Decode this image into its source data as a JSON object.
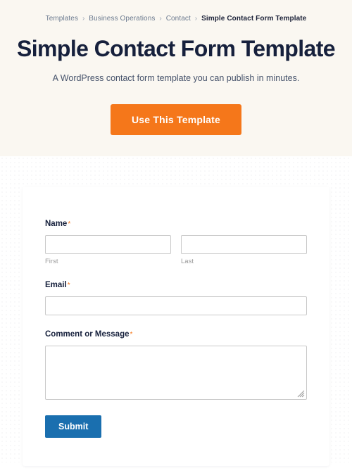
{
  "breadcrumb": {
    "separator": "›",
    "items": [
      {
        "label": "Templates",
        "current": false
      },
      {
        "label": "Business Operations",
        "current": false
      },
      {
        "label": "Contact",
        "current": false
      },
      {
        "label": "Simple Contact Form Template",
        "current": true
      }
    ]
  },
  "hero": {
    "title": "Simple Contact Form Template",
    "subtitle": "A WordPress contact form template you can publish in minutes.",
    "cta_label": "Use This Template",
    "background_color": "#FAF7F1",
    "cta_color": "#F5771A"
  },
  "form": {
    "required_marker": "*",
    "fields": [
      {
        "id": "name",
        "label": "Name",
        "required": true,
        "type": "name-split",
        "parts": [
          {
            "id": "first",
            "sub_label": "First",
            "value": "",
            "placeholder": ""
          },
          {
            "id": "last",
            "sub_label": "Last",
            "value": "",
            "placeholder": ""
          }
        ]
      },
      {
        "id": "email",
        "label": "Email",
        "required": true,
        "type": "text",
        "value": "",
        "placeholder": ""
      },
      {
        "id": "message",
        "label": "Comment or Message",
        "required": true,
        "type": "textarea",
        "value": "",
        "placeholder": ""
      }
    ],
    "submit_label": "Submit",
    "submit_color": "#1A6FAF",
    "border_color": "#C9C9C9"
  }
}
